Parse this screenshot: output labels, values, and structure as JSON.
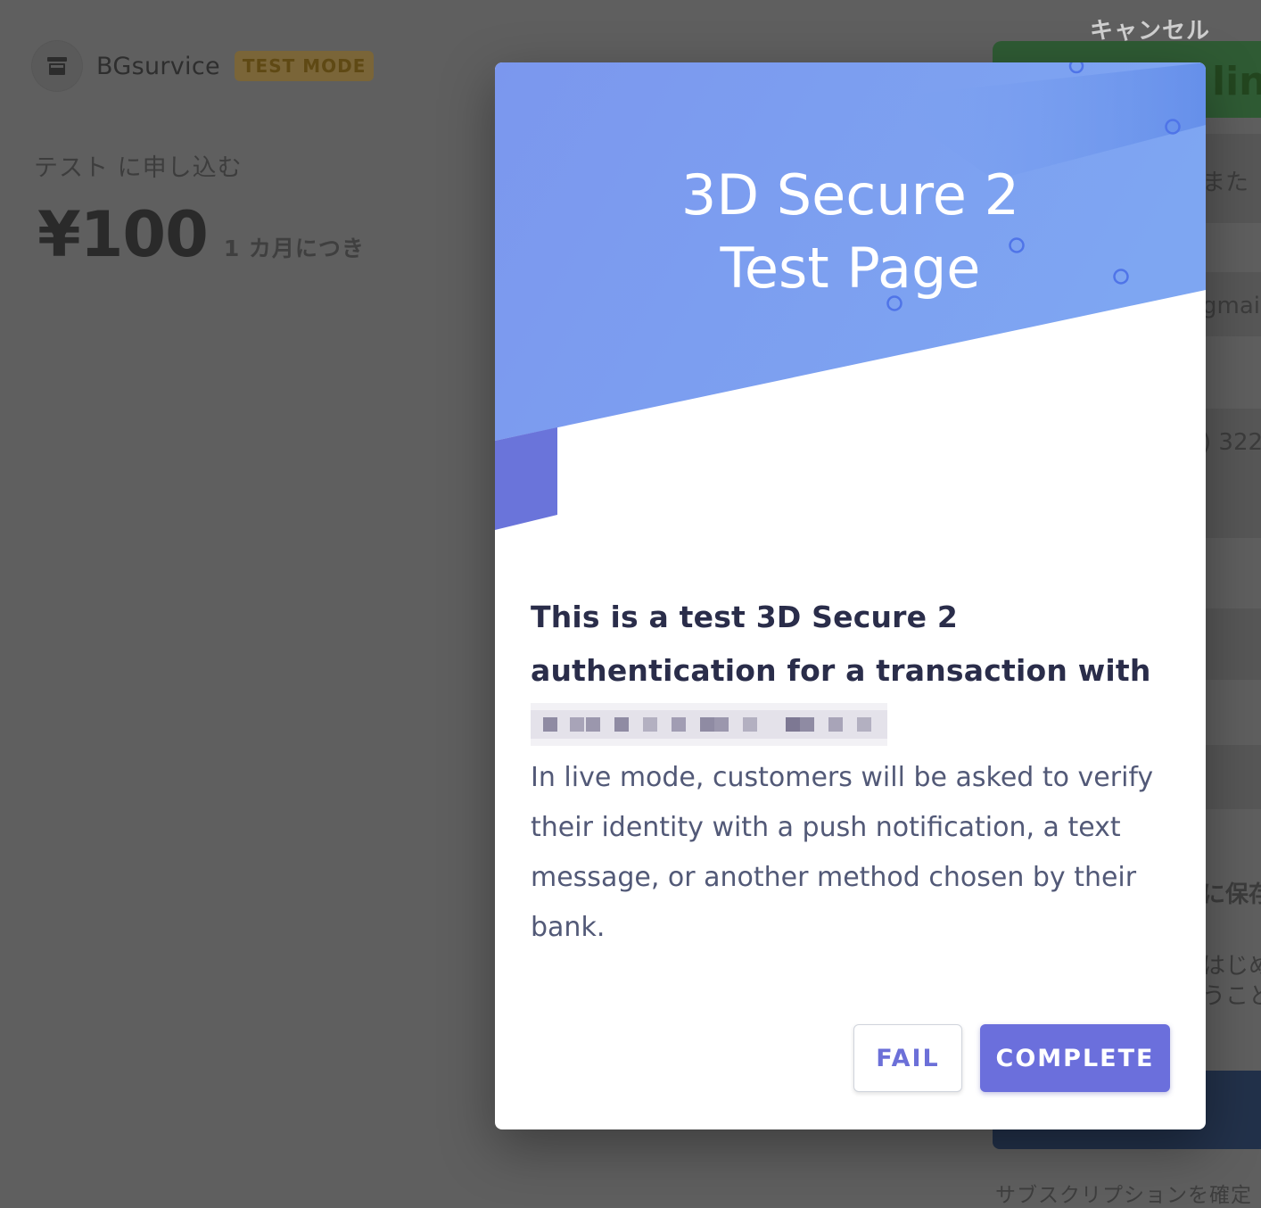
{
  "background_page": {
    "merchant_name": "BGsurvice",
    "mode_badge": "TEST MODE",
    "subscribe_label": "テスト に申し込む",
    "price": "¥100",
    "period": "1 カ月につき",
    "cancel_label": "キャンセル",
    "link_button_partial": "lin",
    "partial_texts": [
      "また",
      "gmai",
      ") 322",
      "に保存",
      "はじめ",
      "うこと"
    ],
    "bottom_note_partial": "サブスクリプションを確定"
  },
  "modal": {
    "title_line1": "3D Secure 2",
    "title_line2": "Test Page",
    "heading": "This is a test 3D Secure 2 authentication for a transaction with",
    "info": "In live mode, customers will be asked to verify their identity with a push notification, a text message, or another method chosen by their bank.",
    "fail_label": "FAIL",
    "complete_label": "COMPLETE"
  },
  "colors": {
    "accent": "#6b6fdc",
    "header_blue": "#7c9cf0",
    "overlay": "#5f5f5f"
  }
}
